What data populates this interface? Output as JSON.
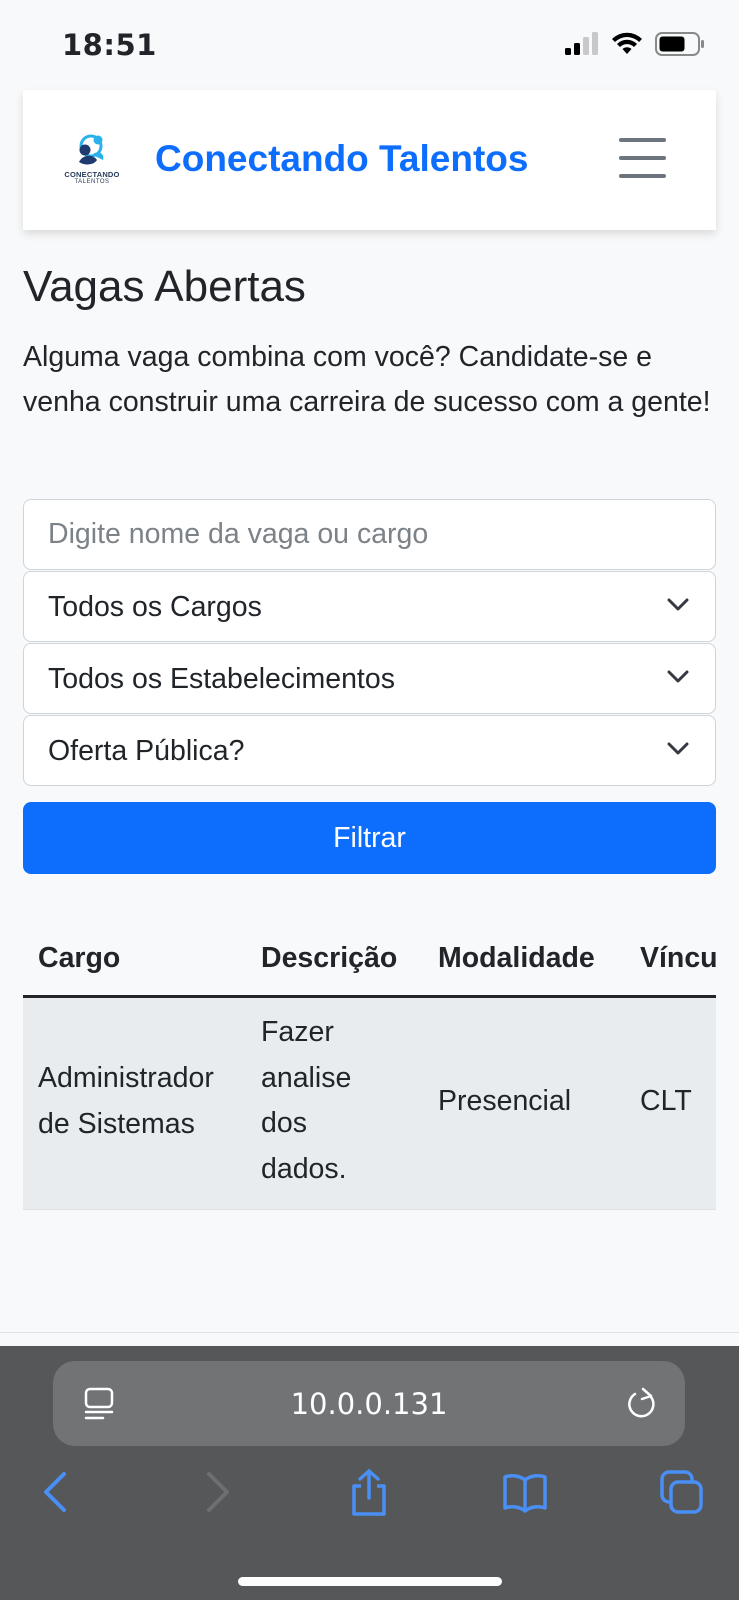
{
  "status_bar": {
    "time": "18:51"
  },
  "navbar": {
    "logo_line1": "CONECTANDO",
    "logo_line2": "TALENTOS",
    "brand": "Conectando Talentos"
  },
  "page": {
    "title": "Vagas Abertas",
    "intro": "Alguma vaga combina com você? Candidate-se e venha construir uma carreira de sucesso com a gente!"
  },
  "filters": {
    "search_placeholder": "Digite nome da vaga ou cargo",
    "cargo_select": "Todos os Cargos",
    "estabelecimento_select": "Todos os Estabelecimentos",
    "oferta_select": "Oferta Pública?",
    "filter_button": "Filtrar"
  },
  "table": {
    "headers": [
      "Cargo",
      "Descrição",
      "Modalidade",
      "Víncu"
    ],
    "rows": [
      {
        "cargo_line1": "Administrador",
        "cargo_line2": "de Sistemas",
        "descricao_lines": [
          "Fazer",
          "analise",
          "dos",
          "dados."
        ],
        "modalidade": "Presencial",
        "vinculo": "CLT"
      }
    ]
  },
  "browser": {
    "url": "10.0.0.131"
  },
  "colors": {
    "primary": "#0d6efd",
    "toolbar": "#555758",
    "toolbar_icon": "#4a8ff5"
  }
}
